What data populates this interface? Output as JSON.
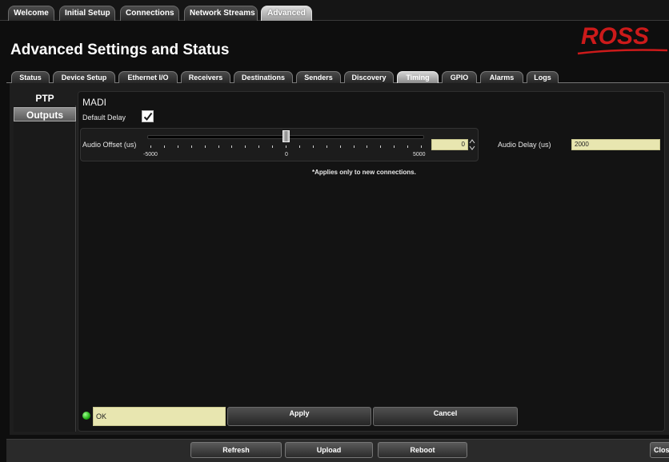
{
  "top_tabs": [
    {
      "label": "Welcome",
      "active": false
    },
    {
      "label": "Initial Setup",
      "active": false
    },
    {
      "label": "Connections",
      "active": false
    },
    {
      "label": "Network Streams",
      "active": false
    },
    {
      "label": "Advanced",
      "active": true
    }
  ],
  "header": {
    "title": "Advanced Settings and Status",
    "logo_text": "ROSS",
    "logo_color": "#cc1a1a"
  },
  "sub_tabs": [
    {
      "label": "Status",
      "active": false
    },
    {
      "label": "Device Setup",
      "active": false
    },
    {
      "label": "Ethernet I/O",
      "active": false
    },
    {
      "label": "Receivers",
      "active": false
    },
    {
      "label": "Destinations",
      "active": false
    },
    {
      "label": "Senders",
      "active": false
    },
    {
      "label": "Discovery",
      "active": false
    },
    {
      "label": "Timing",
      "active": true
    },
    {
      "label": "GPIO",
      "active": false
    },
    {
      "label": "Alarms",
      "active": false
    },
    {
      "label": "Logs",
      "active": false
    }
  ],
  "side_nav": [
    {
      "label": "PTP",
      "active": false
    },
    {
      "label": "Outputs",
      "active": true
    }
  ],
  "madi": {
    "section_title": "MADI",
    "default_delay_label": "Default Delay",
    "default_delay_checked": true,
    "audio_offset_label": "Audio Offset (us)",
    "slider_min_label": "-5000",
    "slider_mid_label": "0",
    "slider_max_label": "5000",
    "slider_value": 0,
    "offset_value": "0",
    "audio_delay_label": "Audio Delay (us)",
    "audio_delay_value": "2000",
    "note": "*Applies only to new connections."
  },
  "status": {
    "text": "OK",
    "led_color": "#22b014"
  },
  "actions": {
    "apply_label": "Apply",
    "cancel_label": "Cancel"
  },
  "footer": {
    "refresh_label": "Refresh",
    "upload_label": "Upload",
    "reboot_label": "Reboot",
    "close_label": "Close"
  }
}
